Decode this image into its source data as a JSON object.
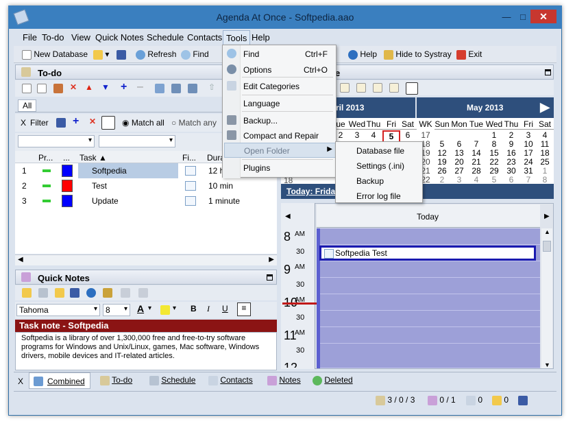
{
  "window": {
    "title": "Agenda At Once - Softpedia.aao"
  },
  "menubar": [
    "File",
    "To-do",
    "View",
    "Quick Notes",
    "Schedule",
    "Contacts",
    "Tools",
    "Help"
  ],
  "toolbar": {
    "new_database": "New Database",
    "refresh": "Refresh",
    "find": "Find",
    "help": "Help",
    "hide_to_systray": "Hide to Systray",
    "exit": "Exit"
  },
  "todo_panel": {
    "title": "To-do",
    "tab_all": "All",
    "filter_label": "Filter",
    "match_all": "Match all",
    "match_any": "Match any",
    "columns": [
      "Pr...",
      "...",
      "Task",
      "Fi...",
      "Dura"
    ],
    "rows": [
      {
        "num": "1",
        "color": "#0000ff",
        "task": "Softpedia",
        "duration": "12 h"
      },
      {
        "num": "2",
        "color": "#ff0000",
        "task": "Test",
        "duration": "10 min"
      },
      {
        "num": "3",
        "color": "#0000ff",
        "task": "Update",
        "duration": "1 minute"
      }
    ]
  },
  "quick_notes": {
    "title": "Quick Notes",
    "font_name": "Tahoma",
    "font_size": "8",
    "note_title": "Task note - Softpedia",
    "note_body": "Softpedia is a library of over 1,300,000 free and free-to-try software programs for Windows and Unix/Linux, games, Mac software, Windows drivers, mobile devices and IT-related articles."
  },
  "tools_menu": {
    "items": [
      {
        "label": "Find",
        "shortcut": "Ctrl+F"
      },
      {
        "label": "Options",
        "shortcut": "Ctrl+O"
      },
      {
        "label": "Edit Categories",
        "shortcut": ""
      },
      {
        "label": "Language",
        "shortcut": ""
      },
      {
        "label": "Backup...",
        "shortcut": ""
      },
      {
        "label": "Compact and Repair",
        "shortcut": ""
      },
      {
        "label": "Open Folder",
        "shortcut": ""
      },
      {
        "label": "Plugins",
        "shortcut": ""
      }
    ]
  },
  "open_folder_submenu": [
    "Database file",
    "Settings (.ini)",
    "Backup",
    "Error log file"
  ],
  "calendar": {
    "april_label": "ril 2013",
    "may_label": "May 2013",
    "april_headers": [
      "ue",
      "Wed",
      "Thu",
      "Fri",
      "Sat"
    ],
    "may_headers": [
      "WK",
      "Sun",
      "Mon",
      "Tue",
      "Wed",
      "Thu",
      "Fri",
      "Sat"
    ],
    "april_partial_rows": [
      [
        "2",
        "3",
        "4",
        "5",
        "6"
      ]
    ],
    "may_rows": [
      [
        "17",
        "",
        "",
        "",
        "1",
        "2",
        "3",
        "4"
      ],
      [
        "18",
        "5",
        "6",
        "7",
        "8",
        "9",
        "10",
        "11"
      ],
      [
        "19",
        "12",
        "13",
        "14",
        "15",
        "16",
        "17",
        "18"
      ],
      [
        "20",
        "19",
        "20",
        "21",
        "22",
        "23",
        "24",
        "25"
      ],
      [
        "21",
        "26",
        "27",
        "28",
        "29",
        "30",
        "31",
        "1"
      ],
      [
        "22",
        "2",
        "3",
        "4",
        "5",
        "6",
        "7",
        "8"
      ]
    ],
    "week18_label": "18",
    "today_label": "Today: Frida",
    "today_column": "Today",
    "event": "Softpedia Test",
    "hours": [
      {
        "hour": "8",
        "ampm": "AM",
        "half": "30"
      },
      {
        "hour": "9",
        "ampm": "AM",
        "half": "30"
      },
      {
        "hour": "10",
        "ampm": "AM",
        "half": "30"
      },
      {
        "hour": "11",
        "ampm": "AM",
        "half": "30"
      },
      {
        "hour": "12",
        "ampm": "",
        "half": ""
      }
    ]
  },
  "bottom_tabs": [
    "Combined",
    "To-do",
    "Schedule",
    "Contacts",
    "Notes",
    "Deleted"
  ],
  "statusbar": {
    "todo_count": "3 / 0 / 3",
    "notes_count": "0 / 1",
    "contacts_count": "0",
    "deleted_count": "0"
  }
}
